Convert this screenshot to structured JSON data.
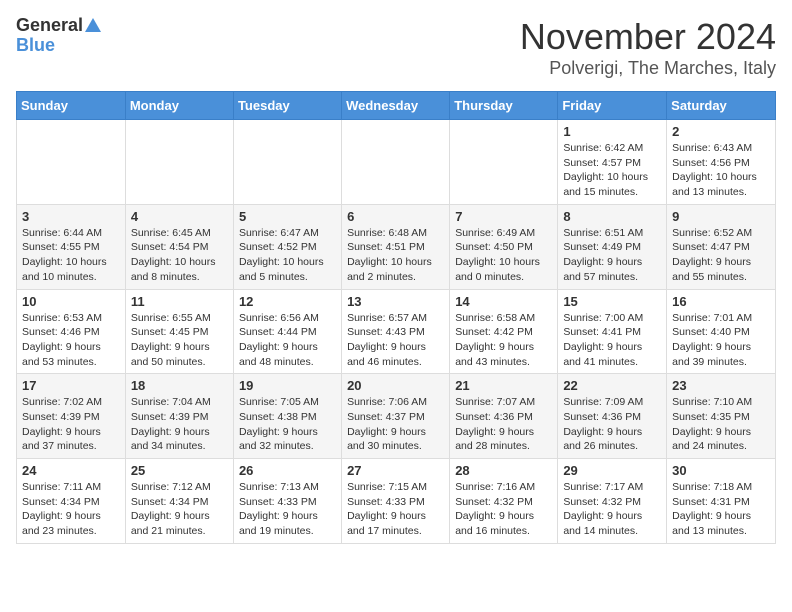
{
  "header": {
    "logo_line1": "General",
    "logo_line2": "Blue",
    "title": "November 2024",
    "subtitle": "Polverigi, The Marches, Italy"
  },
  "weekdays": [
    "Sunday",
    "Monday",
    "Tuesday",
    "Wednesday",
    "Thursday",
    "Friday",
    "Saturday"
  ],
  "weeks": [
    [
      {
        "day": "",
        "info": ""
      },
      {
        "day": "",
        "info": ""
      },
      {
        "day": "",
        "info": ""
      },
      {
        "day": "",
        "info": ""
      },
      {
        "day": "",
        "info": ""
      },
      {
        "day": "1",
        "info": "Sunrise: 6:42 AM\nSunset: 4:57 PM\nDaylight: 10 hours and 15 minutes."
      },
      {
        "day": "2",
        "info": "Sunrise: 6:43 AM\nSunset: 4:56 PM\nDaylight: 10 hours and 13 minutes."
      }
    ],
    [
      {
        "day": "3",
        "info": "Sunrise: 6:44 AM\nSunset: 4:55 PM\nDaylight: 10 hours and 10 minutes."
      },
      {
        "day": "4",
        "info": "Sunrise: 6:45 AM\nSunset: 4:54 PM\nDaylight: 10 hours and 8 minutes."
      },
      {
        "day": "5",
        "info": "Sunrise: 6:47 AM\nSunset: 4:52 PM\nDaylight: 10 hours and 5 minutes."
      },
      {
        "day": "6",
        "info": "Sunrise: 6:48 AM\nSunset: 4:51 PM\nDaylight: 10 hours and 2 minutes."
      },
      {
        "day": "7",
        "info": "Sunrise: 6:49 AM\nSunset: 4:50 PM\nDaylight: 10 hours and 0 minutes."
      },
      {
        "day": "8",
        "info": "Sunrise: 6:51 AM\nSunset: 4:49 PM\nDaylight: 9 hours and 57 minutes."
      },
      {
        "day": "9",
        "info": "Sunrise: 6:52 AM\nSunset: 4:47 PM\nDaylight: 9 hours and 55 minutes."
      }
    ],
    [
      {
        "day": "10",
        "info": "Sunrise: 6:53 AM\nSunset: 4:46 PM\nDaylight: 9 hours and 53 minutes."
      },
      {
        "day": "11",
        "info": "Sunrise: 6:55 AM\nSunset: 4:45 PM\nDaylight: 9 hours and 50 minutes."
      },
      {
        "day": "12",
        "info": "Sunrise: 6:56 AM\nSunset: 4:44 PM\nDaylight: 9 hours and 48 minutes."
      },
      {
        "day": "13",
        "info": "Sunrise: 6:57 AM\nSunset: 4:43 PM\nDaylight: 9 hours and 46 minutes."
      },
      {
        "day": "14",
        "info": "Sunrise: 6:58 AM\nSunset: 4:42 PM\nDaylight: 9 hours and 43 minutes."
      },
      {
        "day": "15",
        "info": "Sunrise: 7:00 AM\nSunset: 4:41 PM\nDaylight: 9 hours and 41 minutes."
      },
      {
        "day": "16",
        "info": "Sunrise: 7:01 AM\nSunset: 4:40 PM\nDaylight: 9 hours and 39 minutes."
      }
    ],
    [
      {
        "day": "17",
        "info": "Sunrise: 7:02 AM\nSunset: 4:39 PM\nDaylight: 9 hours and 37 minutes."
      },
      {
        "day": "18",
        "info": "Sunrise: 7:04 AM\nSunset: 4:39 PM\nDaylight: 9 hours and 34 minutes."
      },
      {
        "day": "19",
        "info": "Sunrise: 7:05 AM\nSunset: 4:38 PM\nDaylight: 9 hours and 32 minutes."
      },
      {
        "day": "20",
        "info": "Sunrise: 7:06 AM\nSunset: 4:37 PM\nDaylight: 9 hours and 30 minutes."
      },
      {
        "day": "21",
        "info": "Sunrise: 7:07 AM\nSunset: 4:36 PM\nDaylight: 9 hours and 28 minutes."
      },
      {
        "day": "22",
        "info": "Sunrise: 7:09 AM\nSunset: 4:36 PM\nDaylight: 9 hours and 26 minutes."
      },
      {
        "day": "23",
        "info": "Sunrise: 7:10 AM\nSunset: 4:35 PM\nDaylight: 9 hours and 24 minutes."
      }
    ],
    [
      {
        "day": "24",
        "info": "Sunrise: 7:11 AM\nSunset: 4:34 PM\nDaylight: 9 hours and 23 minutes."
      },
      {
        "day": "25",
        "info": "Sunrise: 7:12 AM\nSunset: 4:34 PM\nDaylight: 9 hours and 21 minutes."
      },
      {
        "day": "26",
        "info": "Sunrise: 7:13 AM\nSunset: 4:33 PM\nDaylight: 9 hours and 19 minutes."
      },
      {
        "day": "27",
        "info": "Sunrise: 7:15 AM\nSunset: 4:33 PM\nDaylight: 9 hours and 17 minutes."
      },
      {
        "day": "28",
        "info": "Sunrise: 7:16 AM\nSunset: 4:32 PM\nDaylight: 9 hours and 16 minutes."
      },
      {
        "day": "29",
        "info": "Sunrise: 7:17 AM\nSunset: 4:32 PM\nDaylight: 9 hours and 14 minutes."
      },
      {
        "day": "30",
        "info": "Sunrise: 7:18 AM\nSunset: 4:31 PM\nDaylight: 9 hours and 13 minutes."
      }
    ]
  ]
}
